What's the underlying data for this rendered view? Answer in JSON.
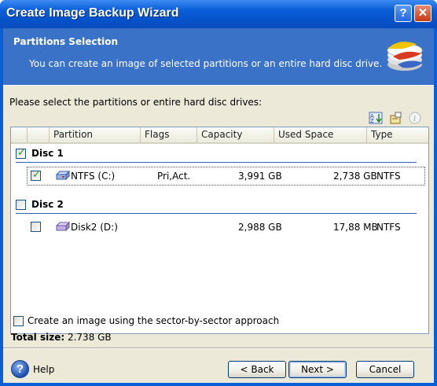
{
  "window": {
    "title": "Create Image Backup Wizard",
    "help_glyph": "?",
    "close_glyph": "✕"
  },
  "header": {
    "title": "Partitions Selection",
    "subtitle": "You can create an image of selected partitions or an entire hard disc drive."
  },
  "prompt": "Please select the partitions or entire hard disc drives:",
  "toolbar": {
    "icons": [
      "sort-az-icon",
      "properties-icon",
      "info-icon"
    ]
  },
  "table": {
    "columns": [
      "Partition",
      "Flags",
      "Capacity",
      "Used Space",
      "Type"
    ],
    "groups": [
      {
        "label": "Disc 1",
        "checked": true,
        "rows": [
          {
            "name": "NTFS (C:)",
            "flags": "Pri,Act.",
            "capacity": "3,991 GB",
            "used": "2,738 GB",
            "type": "NTFS",
            "checked": true,
            "selected": true
          }
        ]
      },
      {
        "label": "Disc 2",
        "checked": false,
        "rows": [
          {
            "name": "Disk2 (D:)",
            "flags": "",
            "capacity": "2,988 GB",
            "used": "17,88 MB",
            "type": "NTFS",
            "checked": false,
            "selected": false
          }
        ]
      }
    ]
  },
  "sector_option": {
    "label": "Create an image using the sector-by-sector approach",
    "checked": false
  },
  "total": {
    "label": "Total size:",
    "value": "2.738 GB"
  },
  "footer": {
    "help_glyph": "?",
    "help_label": "Help",
    "back_label": "< Back",
    "next_label": "Next >",
    "cancel_label": "Cancel"
  },
  "colors": {
    "titlebar": "#0b5fd9",
    "header": "#3a72c8",
    "dialog": "#ece9d8",
    "check": "#21a121",
    "group_line": "#3264b4"
  }
}
